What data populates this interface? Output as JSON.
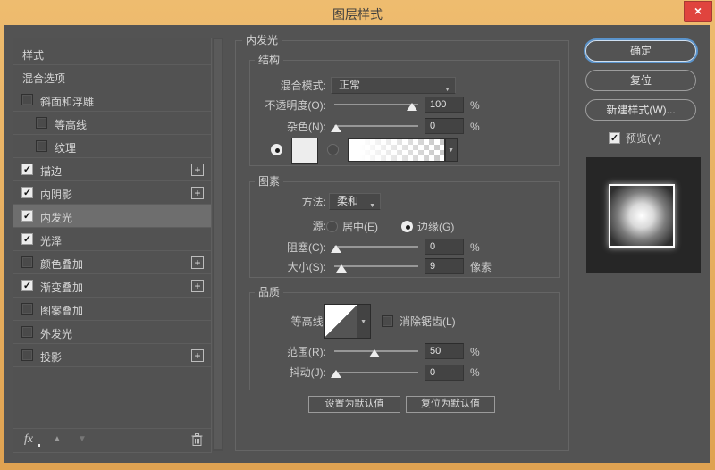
{
  "window": {
    "title": "图层样式",
    "close_glyph": "×"
  },
  "icons": {
    "chevron_down": "▼",
    "plus": "+",
    "check": "✓",
    "arrow_up": "▲",
    "arrow_down": "▼",
    "fx": "fx"
  },
  "colors": {
    "titlebar": "#e8b062",
    "close_button": "#e0443e",
    "dialog_bg": "#535353",
    "selected_item_bg": "#6e6e6e",
    "focus_ring": "#5a93cb",
    "slider_thumb": "#ededed"
  },
  "sidebar": {
    "items": [
      {
        "label": "样式",
        "checked": null,
        "selected": false,
        "plus": false
      },
      {
        "label": "混合选项",
        "checked": null,
        "selected": false,
        "plus": false
      },
      {
        "label": "斜面和浮雕",
        "checked": false,
        "selected": false,
        "plus": false
      },
      {
        "label": "等高线",
        "checked": false,
        "selected": false,
        "plus": false,
        "indent": true
      },
      {
        "label": "纹理",
        "checked": false,
        "selected": false,
        "plus": false,
        "indent": true
      },
      {
        "label": "描边",
        "checked": true,
        "selected": false,
        "plus": true
      },
      {
        "label": "内阴影",
        "checked": true,
        "selected": false,
        "plus": true
      },
      {
        "label": "内发光",
        "checked": true,
        "selected": true,
        "plus": false
      },
      {
        "label": "光泽",
        "checked": true,
        "selected": false,
        "plus": false
      },
      {
        "label": "颜色叠加",
        "checked": false,
        "selected": false,
        "plus": true
      },
      {
        "label": "渐变叠加",
        "checked": true,
        "selected": false,
        "plus": true
      },
      {
        "label": "图案叠加",
        "checked": false,
        "selected": false,
        "plus": false
      },
      {
        "label": "外发光",
        "checked": false,
        "selected": false,
        "plus": false
      },
      {
        "label": "投影",
        "checked": false,
        "selected": false,
        "plus": true
      }
    ]
  },
  "panel": {
    "title": "内发光",
    "structure": {
      "legend": "结构",
      "blend_mode_label": "混合模式:",
      "blend_mode_value": "正常",
      "opacity_label": "不透明度(O):",
      "opacity_value": "100",
      "opacity_unit": "%",
      "noise_label": "杂色(N):",
      "noise_value": "0",
      "noise_unit": "%"
    },
    "elements": {
      "legend": "图素",
      "method_label": "方法:",
      "method_value": "柔和",
      "source_label": "源:",
      "source_center_label": "居中(E)",
      "source_edge_label": "边缘(G)",
      "choke_label": "阻塞(C):",
      "choke_value": "0",
      "choke_unit": "%",
      "size_label": "大小(S):",
      "size_value": "9",
      "size_unit": "像素"
    },
    "quality": {
      "legend": "品质",
      "contour_label": "等高线:",
      "antialias_label": "消除锯齿(L)",
      "range_label": "范围(R):",
      "range_value": "50",
      "range_unit": "%",
      "jitter_label": "抖动(J):",
      "jitter_value": "0",
      "jitter_unit": "%"
    },
    "footer_buttons": {
      "set_default": "设置为默认值",
      "reset_default": "复位为默认值"
    }
  },
  "actions": {
    "ok": "确定",
    "reset": "复位",
    "new_style": "新建样式(W)...",
    "preview": "预览(V)"
  }
}
